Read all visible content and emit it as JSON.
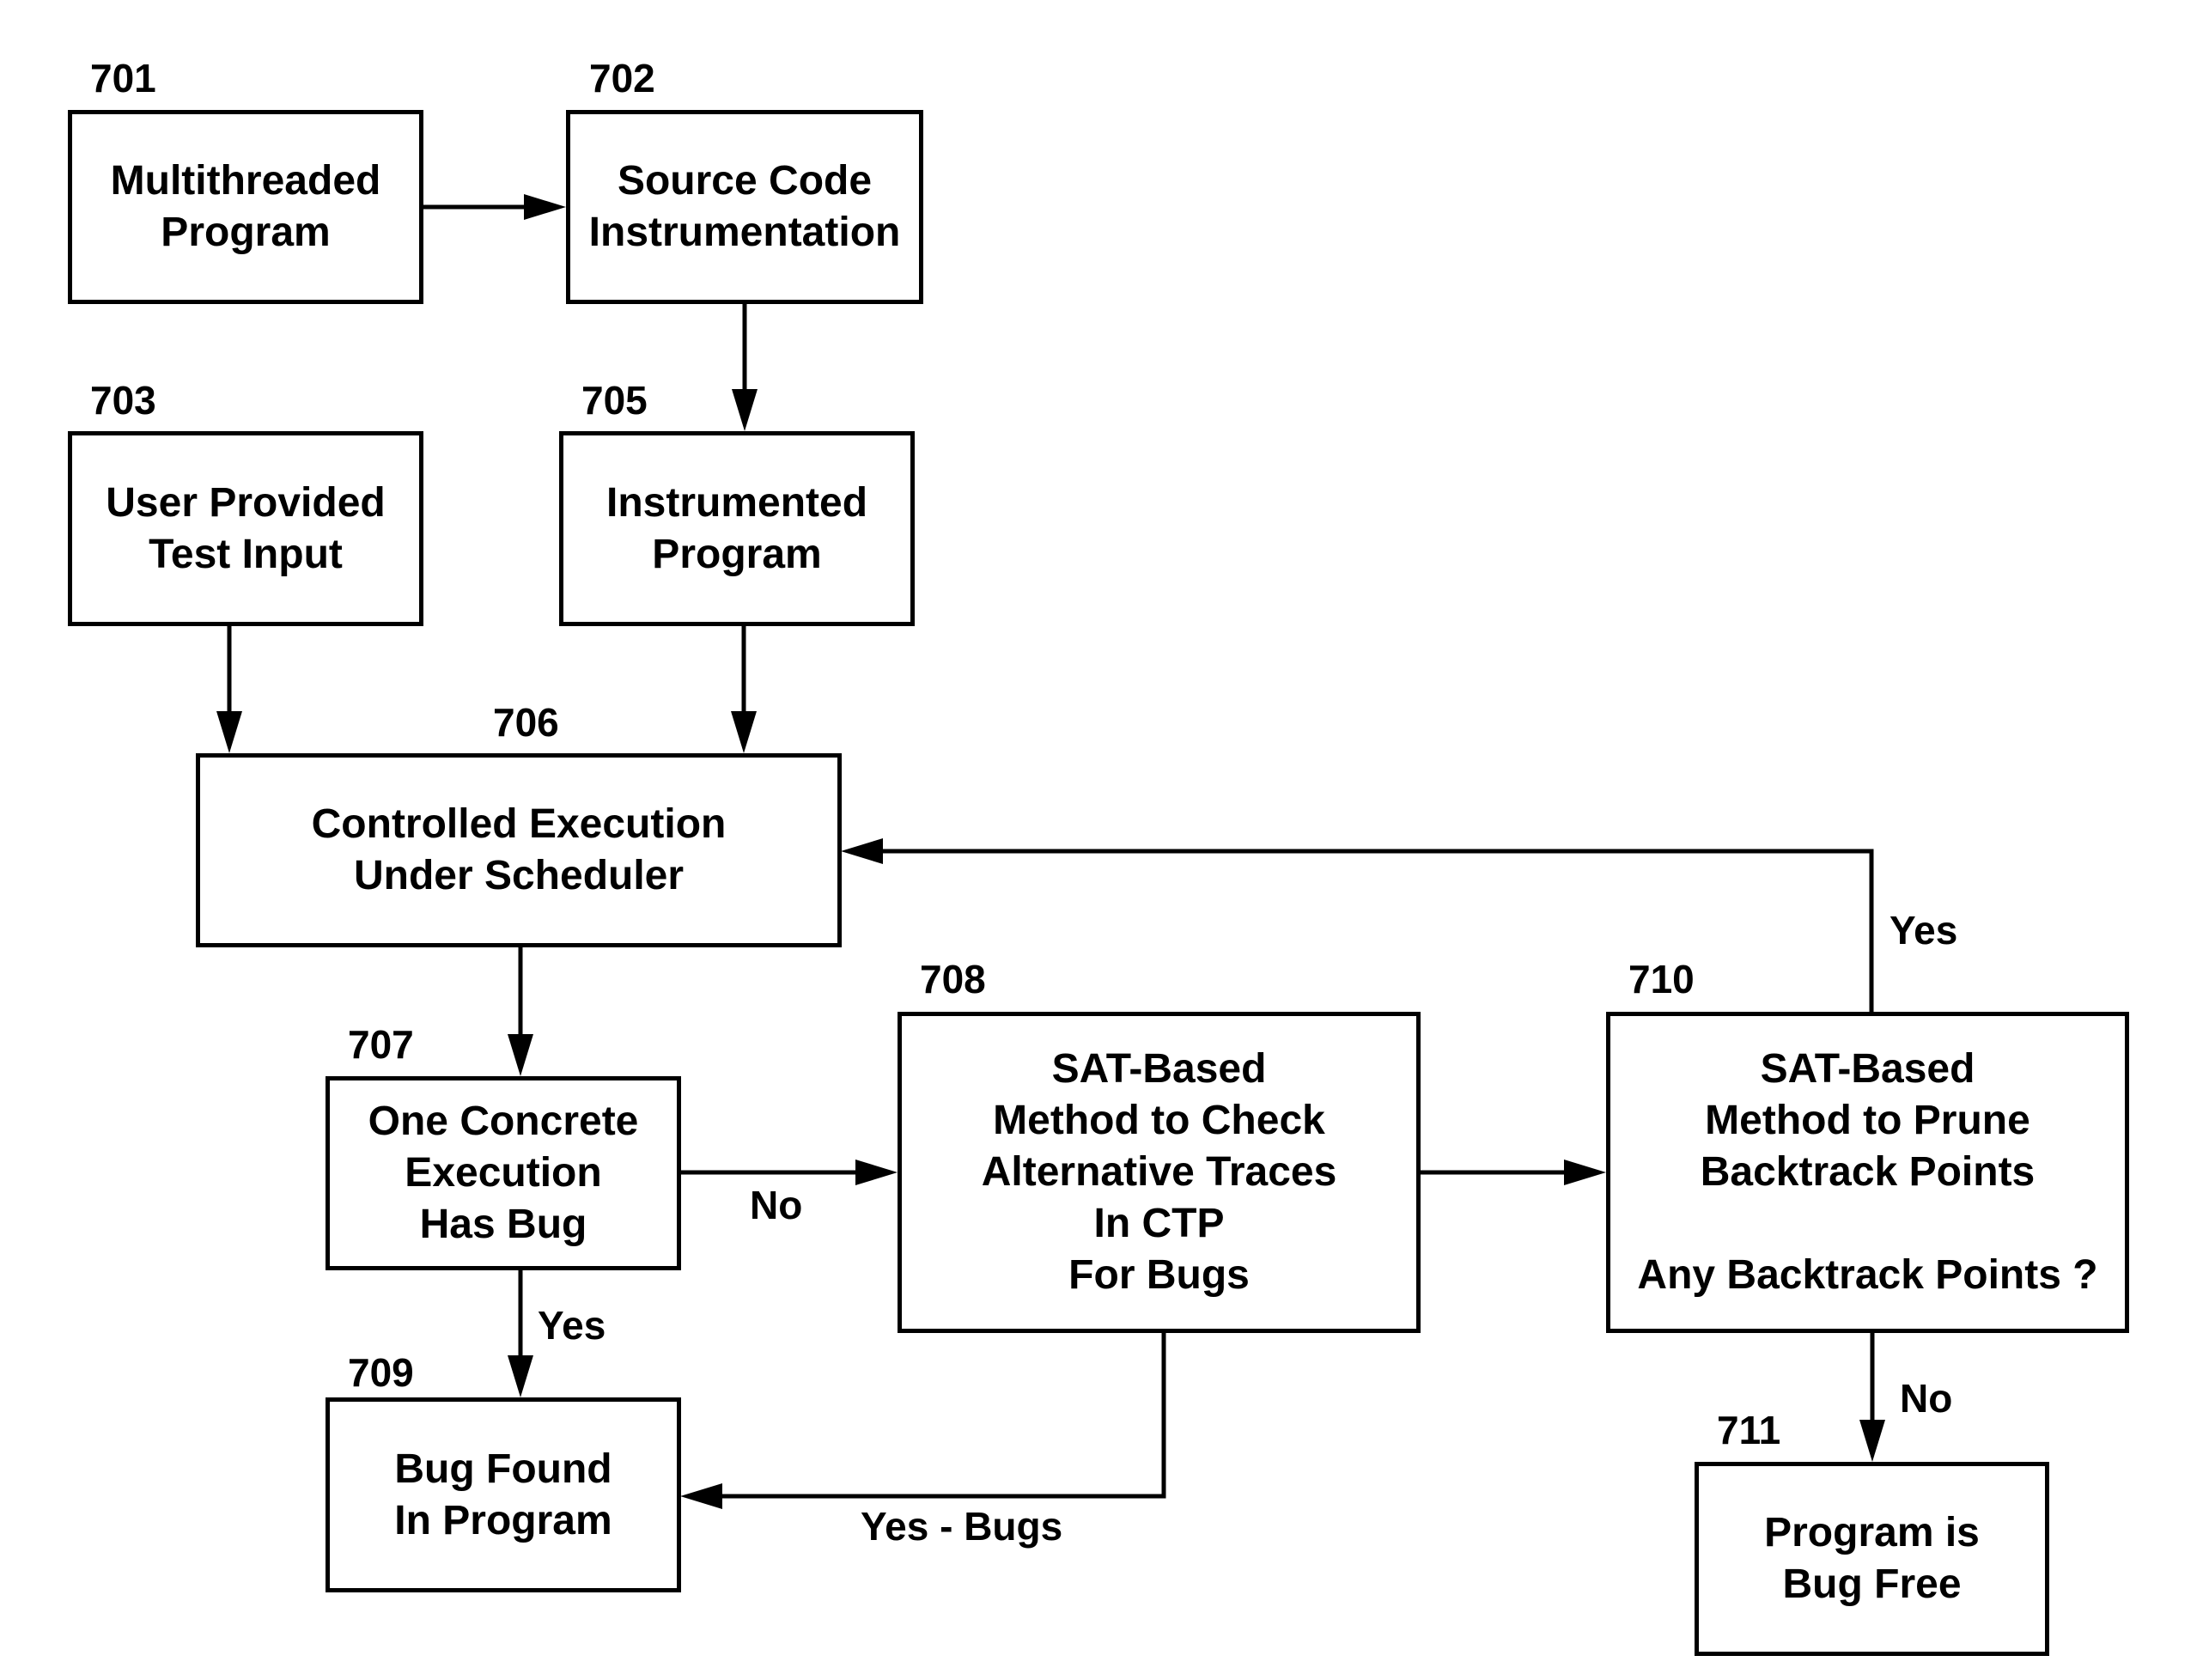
{
  "nodes": {
    "n701": {
      "ref": "701",
      "lines": [
        "Multithreaded",
        "Program"
      ]
    },
    "n702": {
      "ref": "702",
      "lines": [
        "Source Code",
        "Instrumentation"
      ]
    },
    "n703": {
      "ref": "703",
      "lines": [
        "User Provided",
        "Test Input"
      ]
    },
    "n705": {
      "ref": "705",
      "lines": [
        "Instrumented",
        "Program"
      ]
    },
    "n706": {
      "ref": "706",
      "lines": [
        "Controlled Execution",
        "Under Scheduler"
      ]
    },
    "n707": {
      "ref": "707",
      "lines": [
        "One Concrete",
        "Execution",
        "Has Bug"
      ]
    },
    "n708": {
      "ref": "708",
      "lines": [
        "SAT-Based",
        "Method to Check",
        "Alternative Traces",
        "In CTP",
        "For Bugs"
      ]
    },
    "n709": {
      "ref": "709",
      "lines": [
        "Bug Found",
        "In Program"
      ]
    },
    "n710": {
      "ref": "710",
      "lines": [
        "SAT-Based",
        "Method to Prune",
        "Backtrack Points",
        " ",
        "Any Backtrack Points ?"
      ]
    },
    "n711": {
      "ref": "711",
      "lines": [
        "Program is",
        "Bug Free"
      ]
    }
  },
  "edges": [
    {
      "from": "701",
      "to": "702",
      "label": ""
    },
    {
      "from": "702",
      "to": "705",
      "label": ""
    },
    {
      "from": "703",
      "to": "706",
      "label": ""
    },
    {
      "from": "705",
      "to": "706",
      "label": ""
    },
    {
      "from": "706",
      "to": "707",
      "label": ""
    },
    {
      "from": "707",
      "to": "708",
      "label": "No"
    },
    {
      "from": "707",
      "to": "709",
      "label": "Yes"
    },
    {
      "from": "708",
      "to": "709",
      "label": "Yes - Bugs"
    },
    {
      "from": "708",
      "to": "710",
      "label": ""
    },
    {
      "from": "710",
      "to": "706",
      "label": "Yes"
    },
    {
      "from": "710",
      "to": "711",
      "label": "No"
    }
  ],
  "edge_labels": {
    "e707_708": "No",
    "e707_709": "Yes",
    "e708_709": "Yes - Bugs",
    "e710_706": "Yes",
    "e710_711": "No"
  }
}
